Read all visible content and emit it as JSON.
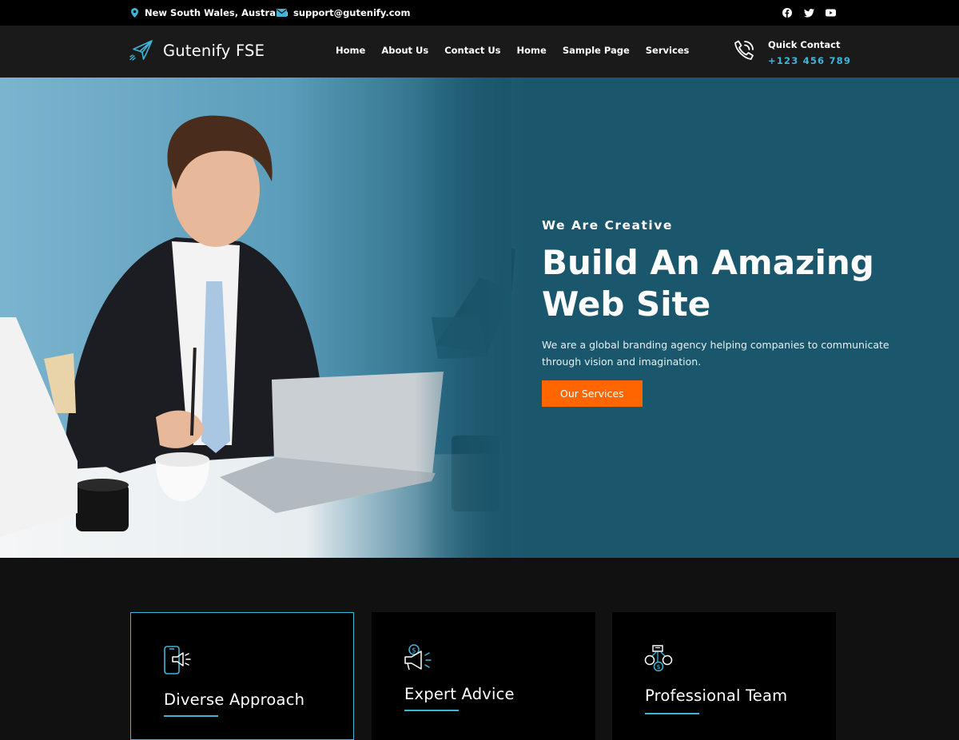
{
  "topbar": {
    "location": "New South Wales, Australia",
    "email": "support@gutenify.com",
    "social": [
      "facebook-icon",
      "twitter-icon",
      "youtube-icon"
    ]
  },
  "header": {
    "logo_text": "Gutenify FSE",
    "nav": [
      "Home",
      "About Us",
      "Contact Us",
      "Home",
      "Sample Page",
      "Services"
    ],
    "quick_contact_title": "Quick Contact",
    "quick_contact_phone": "+123 456 789"
  },
  "hero": {
    "eyebrow": "We Are Creative",
    "headline_line1": "Build An Amazing",
    "headline_line2": "Web Site",
    "description": "We are a global branding agency helping companies to communicate through vision and imagination.",
    "cta_label": "Our Services"
  },
  "features": [
    {
      "title": "Diverse Approach",
      "icon": "mobile-megaphone-icon"
    },
    {
      "title": "Expert Advice",
      "icon": "megaphone-dollar-icon"
    },
    {
      "title": "Professional Team",
      "icon": "team-dollar-icon"
    }
  ],
  "colors": {
    "accent": "#3fb6d8",
    "cta": "#ff6600",
    "hero_bg": "#1a566c",
    "header_bg": "#1a1a1a",
    "topbar_bg": "#000000"
  }
}
